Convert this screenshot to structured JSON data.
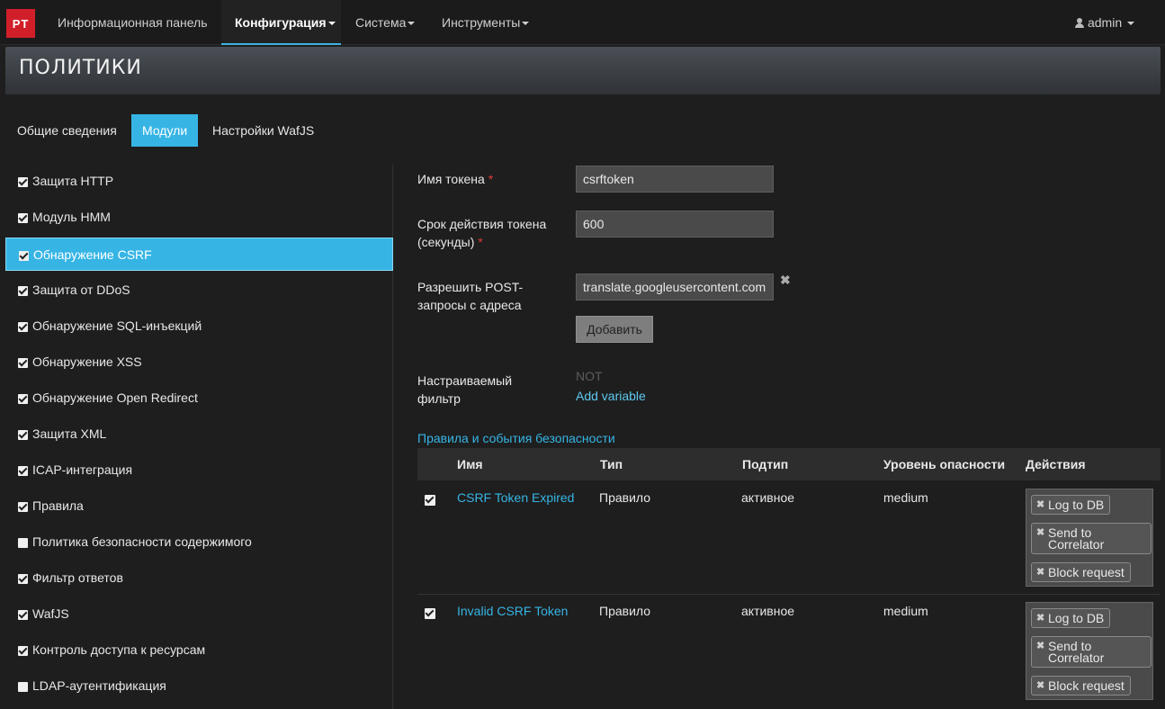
{
  "navbar": {
    "logo": "PT",
    "items": [
      {
        "label": "Информационная панель",
        "dropdown": false
      },
      {
        "label": "Конфигурация",
        "dropdown": true,
        "active": true
      },
      {
        "label": "Система",
        "dropdown": true
      },
      {
        "label": "Инструменты",
        "dropdown": true
      }
    ],
    "user": "admin"
  },
  "page": {
    "title": "ПОЛИТИКИ"
  },
  "tabs": [
    {
      "label": "Общие сведения"
    },
    {
      "label": "Модули",
      "active": true
    },
    {
      "label": "Настройки WafJS"
    }
  ],
  "modules": [
    {
      "label": "Защита HTTP",
      "checked": true
    },
    {
      "label": "Модуль HMM",
      "checked": true
    },
    {
      "label": "Обнаружение CSRF",
      "checked": true,
      "active": true
    },
    {
      "label": "Защита от DDoS",
      "checked": true
    },
    {
      "label": "Обнаружение SQL-инъекций",
      "checked": true
    },
    {
      "label": "Обнаружение XSS",
      "checked": true
    },
    {
      "label": "Обнаружение Open Redirect",
      "checked": true
    },
    {
      "label": "Защита XML",
      "checked": true
    },
    {
      "label": "ICAP-интеграция",
      "checked": true
    },
    {
      "label": "Правила",
      "checked": true
    },
    {
      "label": "Политика безопасности содержимого",
      "checked": false
    },
    {
      "label": "Фильтр ответов",
      "checked": true
    },
    {
      "label": "WafJS",
      "checked": true
    },
    {
      "label": "Контроль доступа к ресурсам",
      "checked": true
    },
    {
      "label": "LDAP-аутентификация",
      "checked": false
    }
  ],
  "form": {
    "token_name_label": "Имя токена",
    "token_name_value": "csrftoken",
    "token_ttl_label_1": "Срок действия токена",
    "token_ttl_label_2": "(секунды)",
    "token_ttl_value": "600",
    "allow_post_label_1": "Разрешить POST-",
    "allow_post_label_2": "запросы с адреса",
    "allow_post_value": "translate.googleusercontent.com",
    "add_button": "Добавить",
    "filter_label_1": "Настраиваемый",
    "filter_label_2": "фильтр",
    "not_text": "NOT",
    "add_variable": "Add variable",
    "required_mark": "*"
  },
  "rules": {
    "section_title": "Правила и события безопасности",
    "columns": [
      "Имя",
      "Тип",
      "Подтип",
      "Уровень опасности",
      "Действия"
    ],
    "rows": [
      {
        "checked": true,
        "name": "CSRF Token Expired",
        "type": "Правило",
        "subtype": "активное",
        "severity": "medium",
        "actions": [
          "Log to DB",
          "Send to Correlator",
          "Block request"
        ]
      },
      {
        "checked": true,
        "name": "Invalid CSRF Token",
        "type": "Правило",
        "subtype": "активное",
        "severity": "medium",
        "actions": [
          "Log to DB",
          "Send to Correlator",
          "Block request"
        ]
      }
    ]
  },
  "colors": {
    "accent": "#36b5e5",
    "logo": "#d11f2a",
    "required": "#e03a3a"
  }
}
